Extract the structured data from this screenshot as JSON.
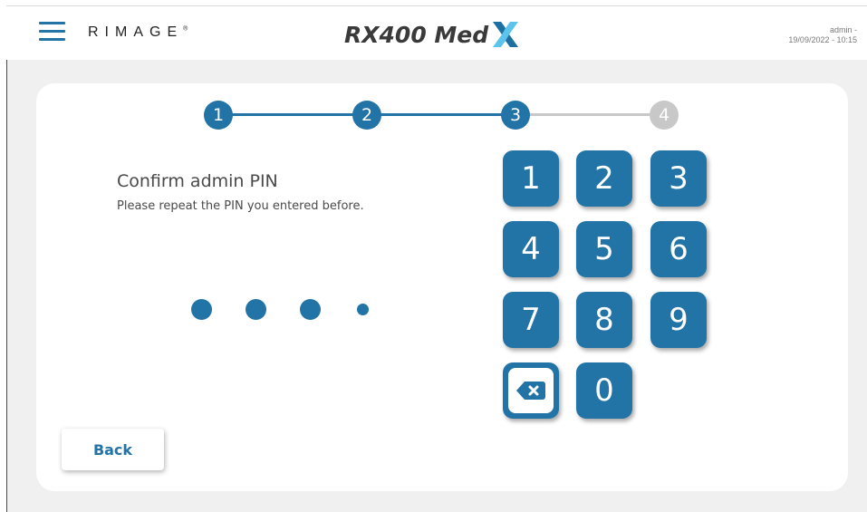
{
  "header": {
    "menu_icon": "hamburger-menu-icon",
    "brand": "RIMAGE",
    "brand_mark": "®",
    "product_title": "RX400 Med",
    "product_logo_icon": "x-logo-icon",
    "user": "admin -",
    "datetime": "19/09/2022 - 10:15"
  },
  "stepper": {
    "steps": [
      "1",
      "2",
      "3",
      "4"
    ],
    "current_step": 3,
    "active_color": "#2273a6",
    "inactive_color": "#c8c8c8"
  },
  "prompt": {
    "title": "Confirm admin PIN",
    "subtitle": "Please repeat the PIN you entered before."
  },
  "pin": {
    "entered_count": 3,
    "length": 4
  },
  "keypad": {
    "keys": [
      "1",
      "2",
      "3",
      "4",
      "5",
      "6",
      "7",
      "8",
      "9",
      "0"
    ],
    "backspace_icon": "backspace-icon"
  },
  "footer": {
    "back_label": "Back"
  },
  "colors": {
    "accent": "#2273a6",
    "background": "#f0f0f0",
    "card": "#ffffff",
    "text": "#4a4a4a"
  }
}
